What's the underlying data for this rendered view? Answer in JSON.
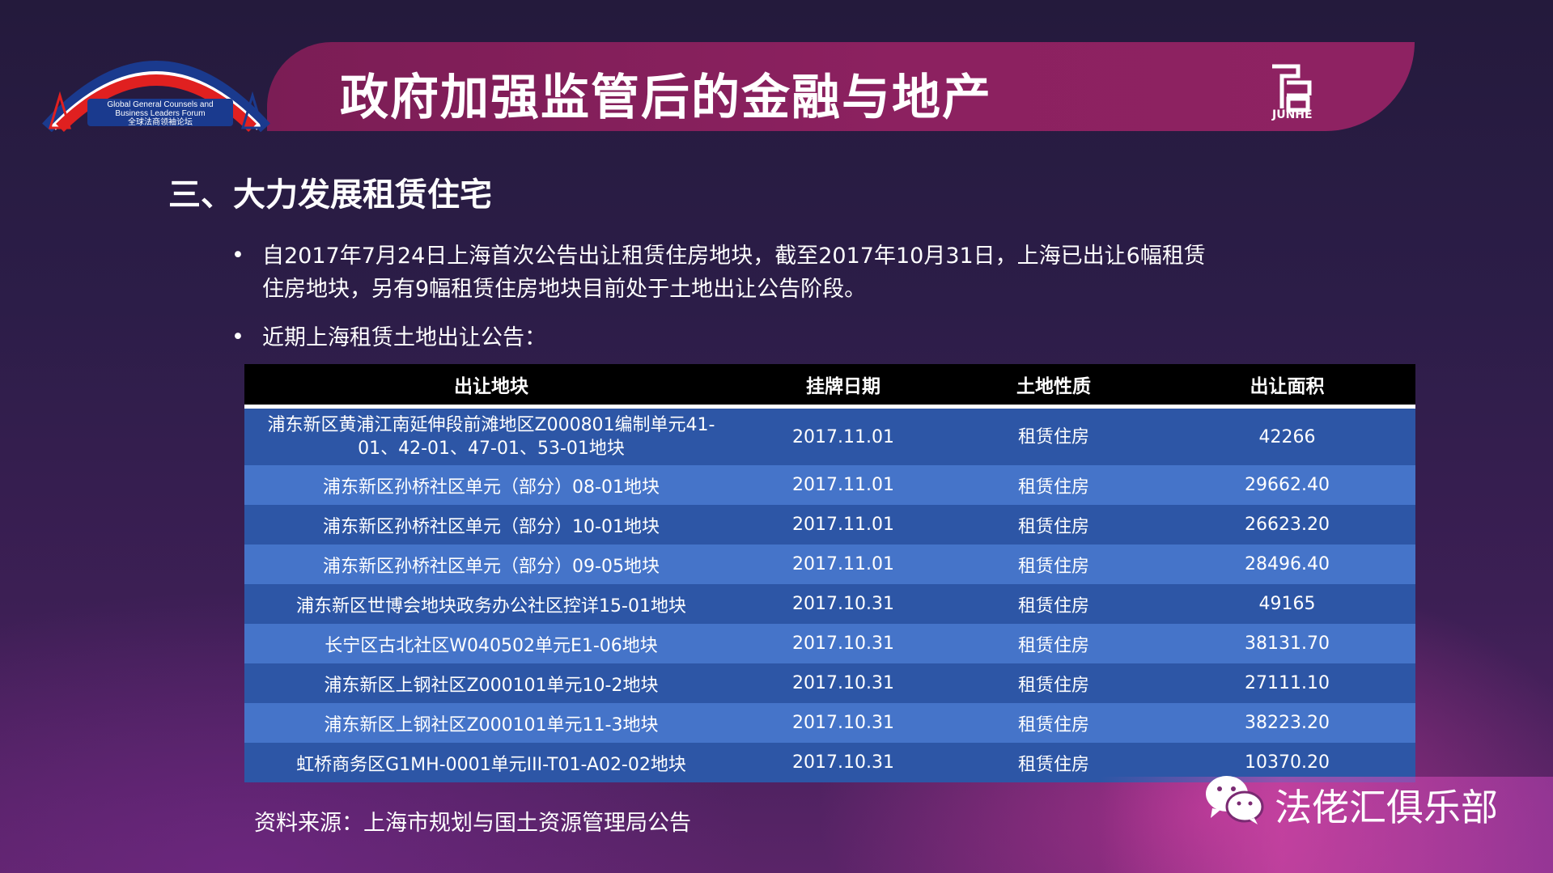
{
  "header": {
    "title": "政府加强监管后的金融与地产",
    "left_logo": {
      "line1": "Global General Counsels and",
      "line2": "Business Leaders Forum",
      "line3": "全球法商领袖论坛"
    },
    "right_logo": {
      "text": "JUNHE",
      "icon": "junhe-logo-icon"
    }
  },
  "section_title": "三、大力发展租赁住宅",
  "bullets": [
    {
      "line1": "自2017年7月24日上海首次公告出让租赁住房地块，截至2017年10月31日，上海已出让6幅租赁",
      "line2": "住房地块，另有9幅租赁住房地块目前处于土地出让公告阶段。"
    },
    {
      "line1": "近期上海租赁土地出让公告："
    }
  ],
  "bullet_symbol": "•",
  "table": {
    "headers": [
      "出让地块",
      "挂牌日期",
      "土地性质",
      "出让面积"
    ],
    "rows": [
      {
        "plot_line1": "浦东新区黄浦江南延伸段前滩地区Z000801编制单元41-",
        "plot_line2": "01、42-01、47-01、53-01地块",
        "date": "2017.11.01",
        "type": "租赁住房",
        "area": "42266"
      },
      {
        "plot": "浦东新区孙桥社区单元（部分）08-01地块",
        "date": "2017.11.01",
        "type": "租赁住房",
        "area": "29662.40"
      },
      {
        "plot": "浦东新区孙桥社区单元（部分）10-01地块",
        "date": "2017.11.01",
        "type": "租赁住房",
        "area": "26623.20"
      },
      {
        "plot": "浦东新区孙桥社区单元（部分）09-05地块",
        "date": "2017.11.01",
        "type": "租赁住房",
        "area": "28496.40"
      },
      {
        "plot": "浦东新区世博会地块政务办公社区控详15-01地块",
        "date": "2017.10.31",
        "type": "租赁住房",
        "area": "49165"
      },
      {
        "plot": "长宁区古北社区W040502单元E1-06地块",
        "date": "2017.10.31",
        "type": "租赁住房",
        "area": "38131.70"
      },
      {
        "plot": "浦东新区上钢社区Z000101单元10-2地块",
        "date": "2017.10.31",
        "type": "租赁住房",
        "area": "27111.10"
      },
      {
        "plot": "浦东新区上钢社区Z000101单元11-3地块",
        "date": "2017.10.31",
        "type": "租赁住房",
        "area": "38223.20"
      },
      {
        "plot": "虹桥商务区G1MH-0001单元III-T01-A02-02地块",
        "date": "2017.10.31",
        "type": "租赁住房",
        "area": "10370.20"
      }
    ]
  },
  "source": "资料来源：上海市规划与国土资源管理局公告",
  "watermark": {
    "text": "法佬汇俱乐部",
    "icon": "wechat-icon"
  },
  "colors": {
    "banner": "#8c2160",
    "row_dark": "#2d56a6",
    "row_light": "#4574c9",
    "header_row": "#000000"
  }
}
